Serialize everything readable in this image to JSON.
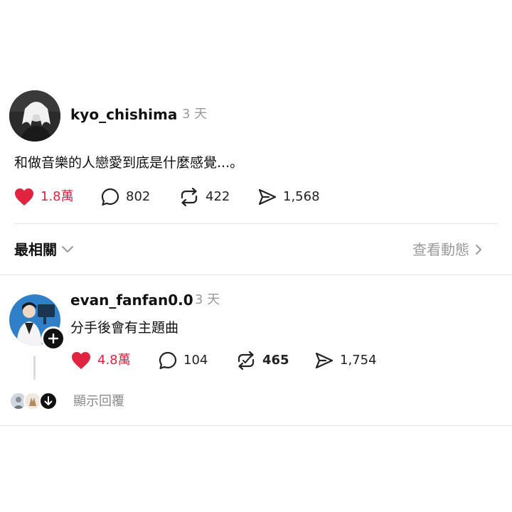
{
  "colors": {
    "like_red": "#e0243f",
    "muted_gray": "#9a9a9a",
    "divider": "#e4e4e4"
  },
  "post": {
    "username": "kyo_chishima",
    "time": "3 天",
    "text": "和做音樂的人戀愛到底是什麼感覺...。",
    "actions": {
      "likes": "1.8萬",
      "comments": "802",
      "reposts": "422",
      "shares": "1,568"
    },
    "liked": true
  },
  "sort_bar": {
    "label": "最相關",
    "activity_label": "查看動態"
  },
  "reply": {
    "username": "evan_fanfan0.0",
    "time": "3 天",
    "text": "分手後會有主題曲",
    "actions": {
      "likes": "4.8萬",
      "comments": "104",
      "reposts": "465",
      "shares": "1,754"
    },
    "liked": true,
    "show_replies_label": "顯示回覆"
  },
  "icons": [
    "heart-icon",
    "comment-icon",
    "repost-icon",
    "share-icon",
    "chevron-down-icon",
    "chevron-right-icon",
    "plus-icon",
    "arrow-down-icon"
  ]
}
